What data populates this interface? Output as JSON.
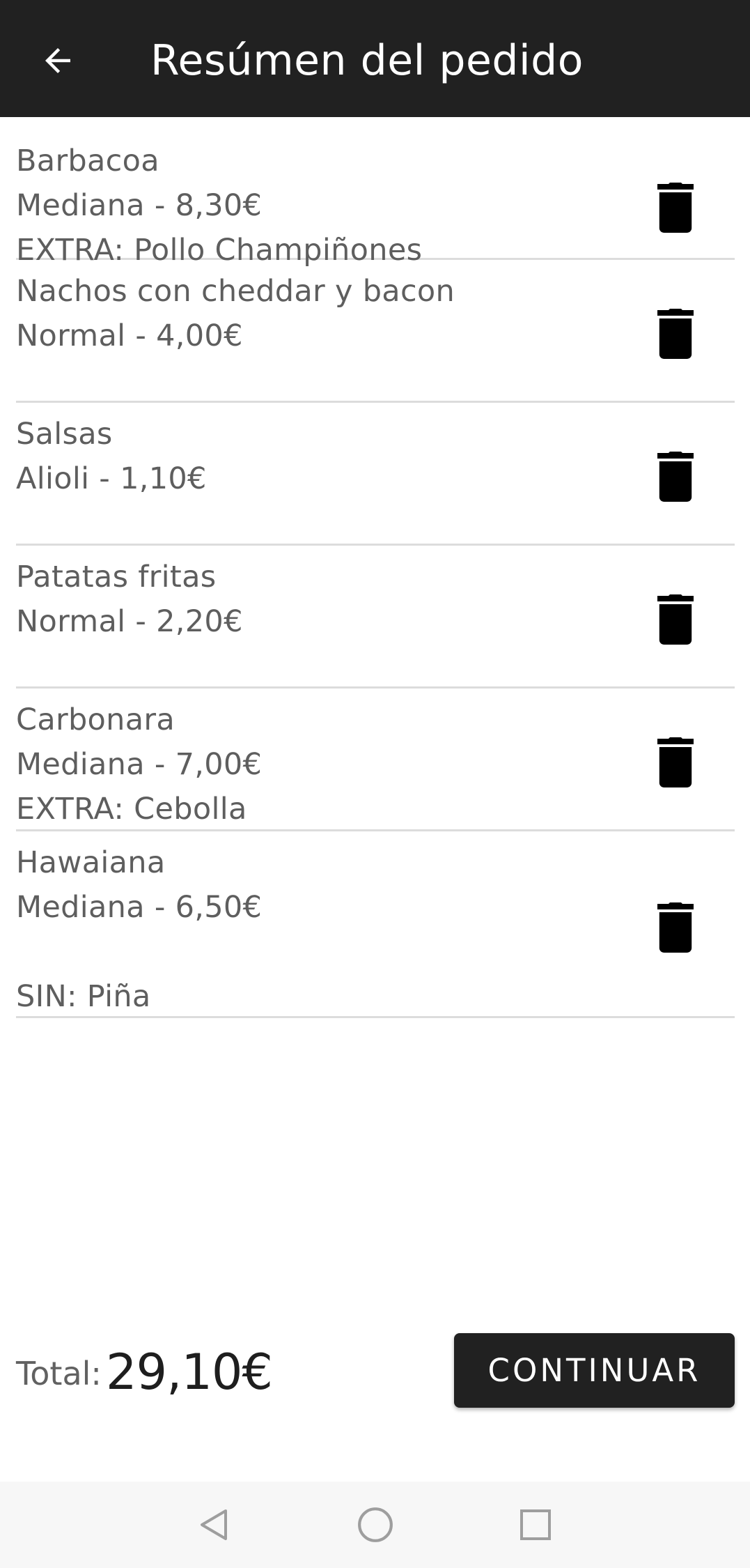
{
  "appbar": {
    "title": "Resúmen del pedido",
    "back_icon": "arrow-back-icon"
  },
  "order_items": [
    {
      "name": "Barbacoa",
      "detail": "Mediana  -  8,30€",
      "extra": "EXTRA: Pollo Champiñones",
      "note": ""
    },
    {
      "name": "Nachos con cheddar y bacon",
      "detail": "Normal  -  4,00€",
      "extra": "",
      "note": ""
    },
    {
      "name": "Salsas",
      "detail": "Alioli  -  1,10€",
      "extra": "",
      "note": ""
    },
    {
      "name": "Patatas fritas",
      "detail": "Normal  -  2,20€",
      "extra": "",
      "note": ""
    },
    {
      "name": "Carbonara",
      "detail": "Mediana  -  7,00€",
      "extra": "EXTRA: Cebolla",
      "note": ""
    },
    {
      "name": "Hawaiana",
      "detail": "Mediana  -  6,50€",
      "extra": "",
      "note": "SIN: Piña"
    }
  ],
  "footer": {
    "total_label": "Total:",
    "total_value": "29,10€",
    "continue_label": "CONTINUAR"
  },
  "icons": {
    "delete": "trash-icon",
    "nav_back": "triangle-back-icon",
    "nav_home": "circle-home-icon",
    "nav_recents": "square-recents-icon"
  },
  "colors": {
    "appbar": "#212121",
    "button": "#212121",
    "text": "#5e5e5e",
    "divider": "#dcdcdc"
  }
}
